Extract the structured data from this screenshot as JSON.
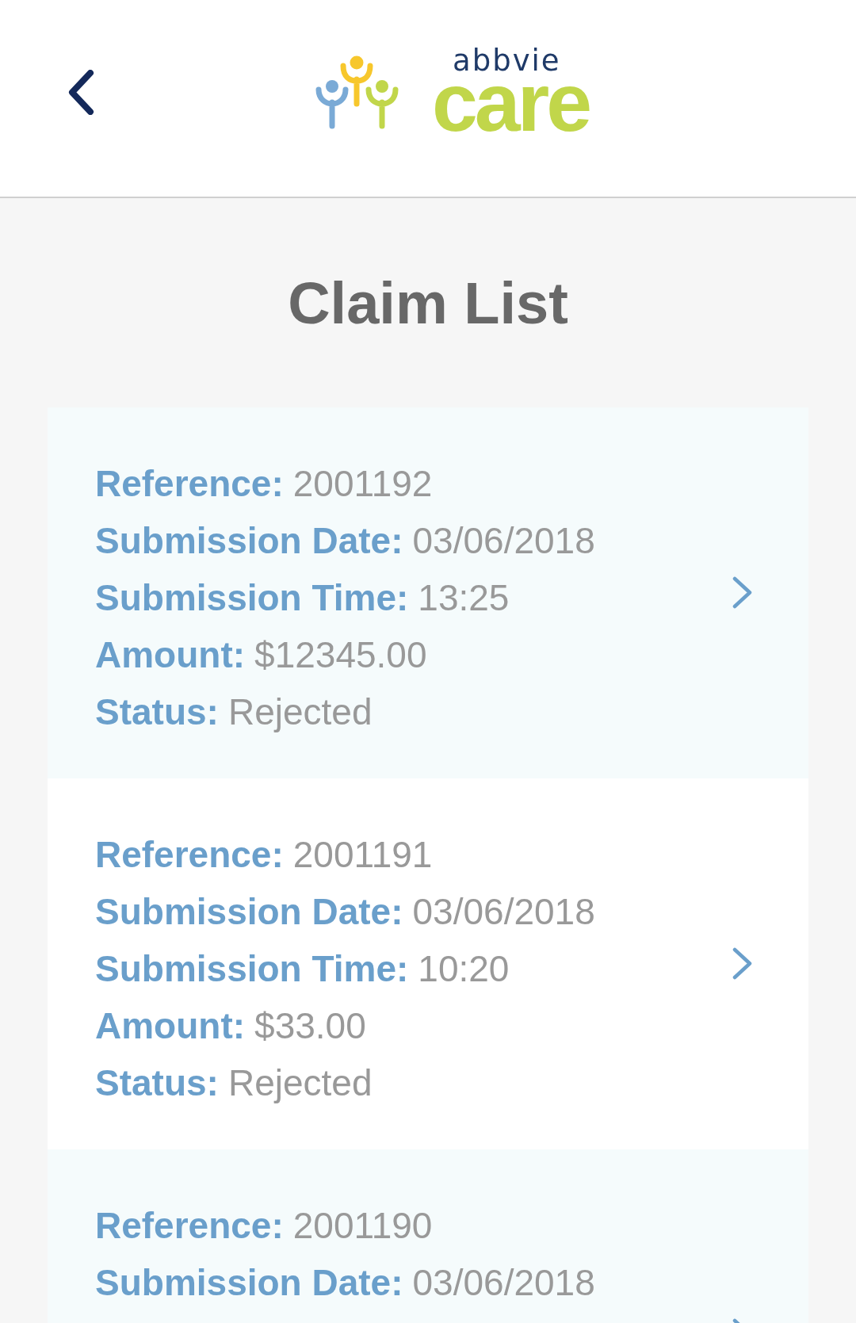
{
  "header": {
    "logo": {
      "brand": "abbvie",
      "product": "care"
    }
  },
  "title": "Claim List",
  "claims": [
    {
      "fields": [
        {
          "label": "Reference:",
          "value": "2001192"
        },
        {
          "label": "Submission Date:",
          "value": "03/06/2018"
        },
        {
          "label": "Submission Time:",
          "value": "13:25"
        },
        {
          "label": "Amount:",
          "value": "$12345.00"
        },
        {
          "label": "Status:",
          "value": "Rejected"
        }
      ]
    },
    {
      "fields": [
        {
          "label": "Reference:",
          "value": "2001191"
        },
        {
          "label": "Submission Date:",
          "value": "03/06/2018"
        },
        {
          "label": "Submission Time:",
          "value": "10:20"
        },
        {
          "label": "Amount:",
          "value": "$33.00"
        },
        {
          "label": "Status:",
          "value": "Rejected"
        }
      ]
    },
    {
      "fields": [
        {
          "label": "Reference:",
          "value": "2001190"
        },
        {
          "label": "Submission Date:",
          "value": "03/06/2018"
        }
      ]
    }
  ]
}
